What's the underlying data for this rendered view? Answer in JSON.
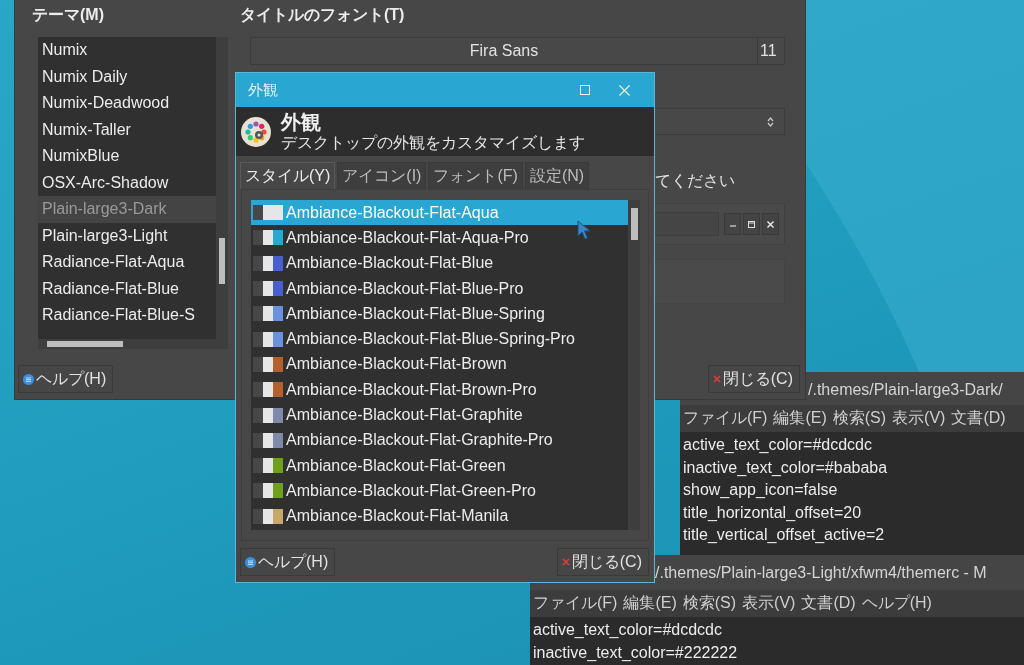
{
  "settings_window": {
    "theme_label": "テーマ(M)",
    "themes": [
      {
        "name": "Numix",
        "selected": false
      },
      {
        "name": "Numix Daily",
        "selected": false
      },
      {
        "name": "Numix-Deadwood",
        "selected": false
      },
      {
        "name": "Numix-Taller",
        "selected": false
      },
      {
        "name": "NumixBlue",
        "selected": false
      },
      {
        "name": "OSX-Arc-Shadow",
        "selected": false
      },
      {
        "name": "Plain-large3-Dark",
        "selected": true
      },
      {
        "name": "Plain-large3-Light",
        "selected": false
      },
      {
        "name": "Radiance-Flat-Aqua",
        "selected": false
      },
      {
        "name": "Radiance-Flat-Blue",
        "selected": false
      },
      {
        "name": "Radiance-Flat-Blue-S",
        "selected": false
      }
    ],
    "title_font_label": "タイトルのフォント(T)",
    "font_name": "Fira Sans",
    "font_size": "11",
    "partial_label": "てください",
    "help_button": "ヘルプ(H)",
    "close_button": "閉じる(C)"
  },
  "appearance_dialog": {
    "title": "外観",
    "header_title": "外観",
    "header_subtitle": "デスクトップの外観をカスタマイズします",
    "tabs": [
      {
        "label": "スタイル(Y)",
        "selected": true
      },
      {
        "label": "アイコン(I)",
        "selected": false
      },
      {
        "label": "フォント(F)",
        "selected": false
      },
      {
        "label": "設定(N)",
        "selected": false
      }
    ],
    "styles": [
      {
        "name": "Ambiance-Blackout-Flat-Aqua",
        "color": "#e6e6e6",
        "selected": true
      },
      {
        "name": "Ambiance-Blackout-Flat-Aqua-Pro",
        "color": "#27a8d0",
        "selected": false
      },
      {
        "name": "Ambiance-Blackout-Flat-Blue",
        "color": "#4a5fcf",
        "selected": false
      },
      {
        "name": "Ambiance-Blackout-Flat-Blue-Pro",
        "color": "#4a5fcf",
        "selected": false
      },
      {
        "name": "Ambiance-Blackout-Flat-Blue-Spring",
        "color": "#6a90de",
        "selected": false
      },
      {
        "name": "Ambiance-Blackout-Flat-Blue-Spring-Pro",
        "color": "#6a90de",
        "selected": false
      },
      {
        "name": "Ambiance-Blackout-Flat-Brown",
        "color": "#b2602f",
        "selected": false
      },
      {
        "name": "Ambiance-Blackout-Flat-Brown-Pro",
        "color": "#b2602f",
        "selected": false
      },
      {
        "name": "Ambiance-Blackout-Flat-Graphite",
        "color": "#7f8aa8",
        "selected": false
      },
      {
        "name": "Ambiance-Blackout-Flat-Graphite-Pro",
        "color": "#7f8aa8",
        "selected": false
      },
      {
        "name": "Ambiance-Blackout-Flat-Green",
        "color": "#6ea01a",
        "selected": false
      },
      {
        "name": "Ambiance-Blackout-Flat-Green-Pro",
        "color": "#6ea01a",
        "selected": false
      },
      {
        "name": "Ambiance-Blackout-Flat-Manila",
        "color": "#c8a86a",
        "selected": false
      }
    ],
    "help_button": "ヘルプ(H)",
    "close_button": "閉じる(C)"
  },
  "editors": [
    {
      "title": "/.themes/Plain-large3-Dark/",
      "menu": [
        "ファイル(F)",
        "編集(E)",
        "検索(S)",
        "表示(V)",
        "文書(D)"
      ],
      "lines": [
        "active_text_color=#dcdcdc",
        "inactive_text_color=#bababa",
        "show_app_icon=false",
        "title_horizontal_offset=20",
        "title_vertical_offset_active=2"
      ]
    },
    {
      "title": "/.themes/Plain-large3-Light/xfwm4/themerc - M",
      "menu": [
        "ファイル(F)",
        "編集(E)",
        "検索(S)",
        "表示(V)",
        "文書(D)",
        "ヘルプ(H)"
      ],
      "lines": [
        "active_text_color=#dcdcdc",
        "inactive_text_color=#222222"
      ]
    }
  ]
}
